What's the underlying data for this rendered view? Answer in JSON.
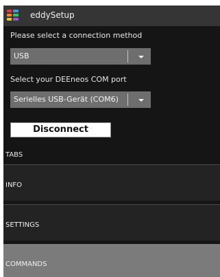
{
  "window": {
    "title": "eddySetup"
  },
  "connection": {
    "method_label": "Please select a connection method",
    "method_value": "USB",
    "port_label": "Select your DEEneos COM port",
    "port_value": "Serielles USB-Gerät (COM6)",
    "disconnect_label": "Disconnect"
  },
  "tabs": {
    "heading": "TABS",
    "items": [
      {
        "label": "INFO"
      },
      {
        "label": "SETTINGS"
      },
      {
        "label": "COMMANDS"
      }
    ]
  },
  "colors": {
    "window_bg": "#151515",
    "titlebar_bg": "#353535",
    "combo_bg": "#6e6e6e",
    "tab_bg": "#232323",
    "tab_active_bg": "#7b7b7b"
  },
  "icons": {
    "app": "app-logo-icon",
    "dropdown": "chevron-down-icon"
  }
}
